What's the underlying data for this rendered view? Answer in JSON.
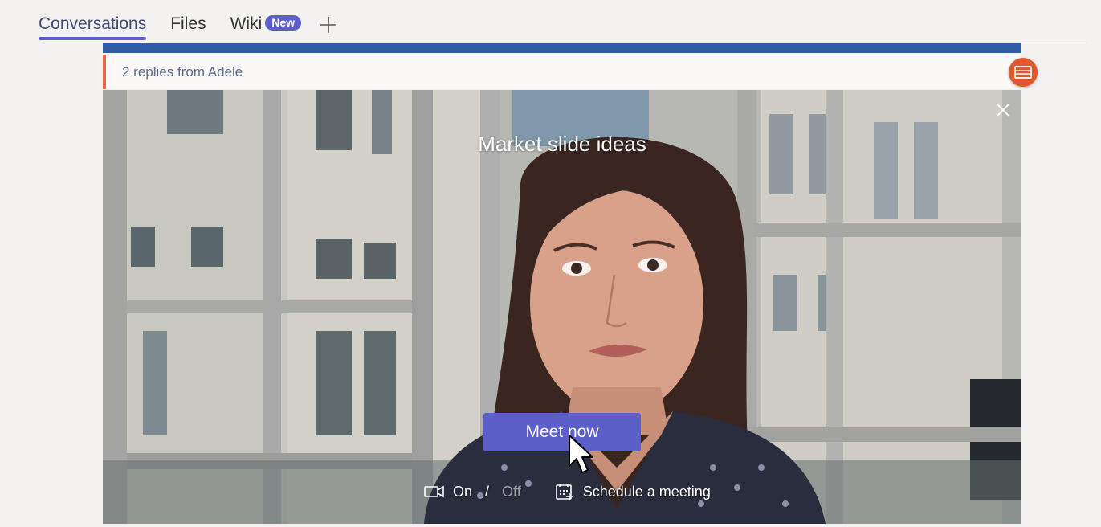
{
  "tabs": [
    {
      "label": "Conversations",
      "active": true
    },
    {
      "label": "Files"
    },
    {
      "label": "Wiki",
      "badge": "New"
    }
  ],
  "post": {
    "replies_text": "2 replies from Adele"
  },
  "video_card": {
    "title": "Market slide ideas",
    "meet_button": "Meet now",
    "video_on_label": "On",
    "separator": "/",
    "video_off_label": "Off",
    "schedule_label": "Schedule a meeting"
  },
  "colors": {
    "accent": "#5b5fc7",
    "post_topbar": "#2f5ba8",
    "replies_border": "#e8693f",
    "card_icon": "#e0582c"
  },
  "icons": [
    "plus-icon",
    "card-icon",
    "close-icon",
    "video-camera-icon",
    "calendar-icon",
    "mouse-cursor"
  ]
}
